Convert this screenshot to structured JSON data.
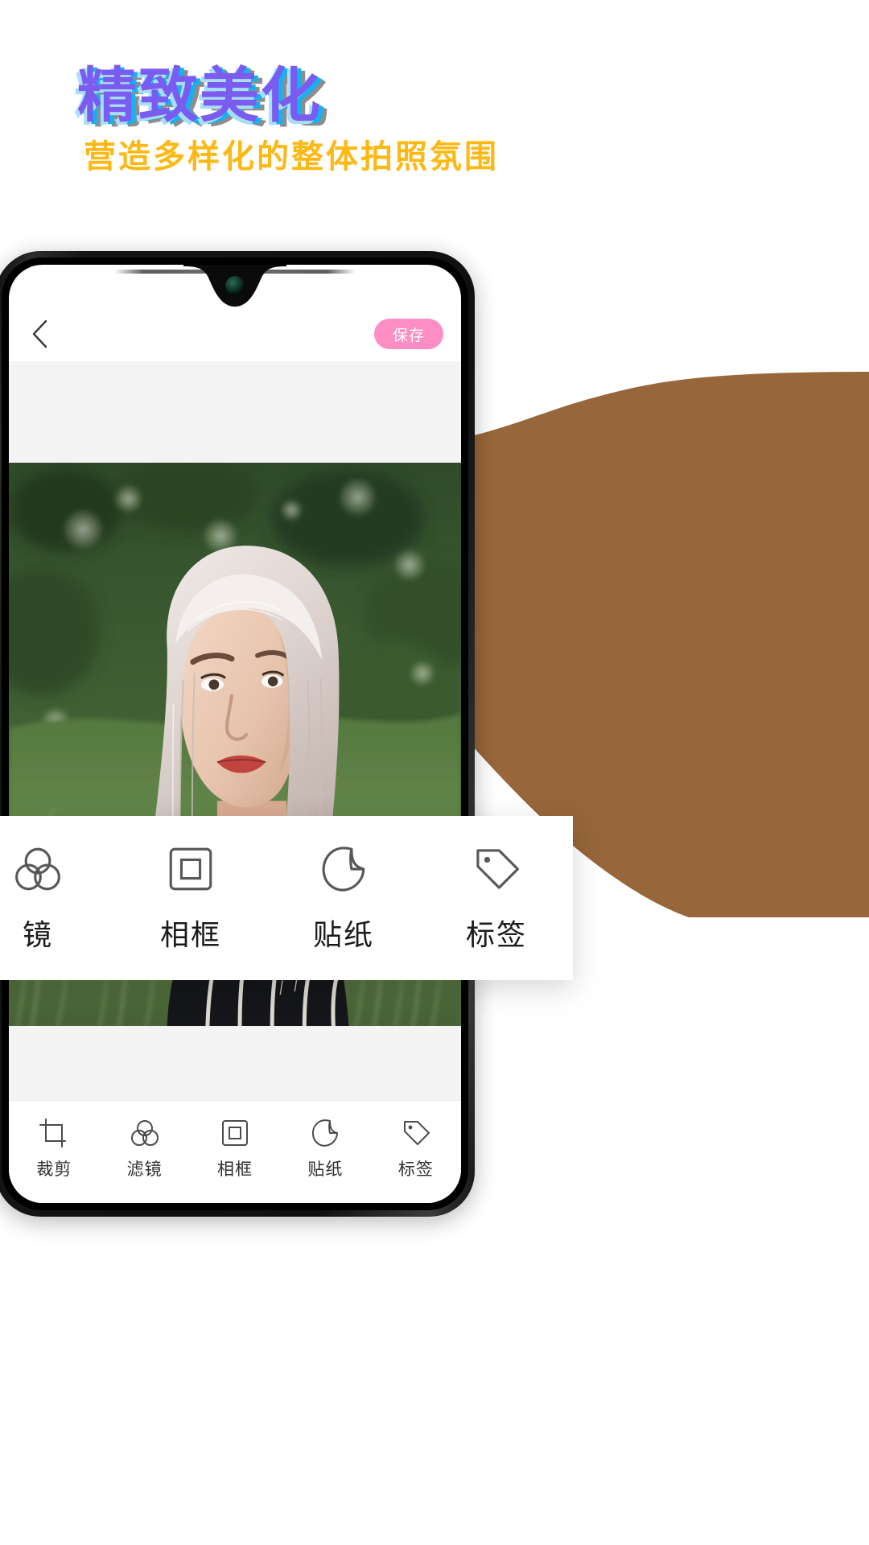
{
  "headings": {
    "title": "精致美化",
    "subtitle": "营造多样化的整体拍照氛围",
    "title_colors": {
      "main": "#7a5cf0",
      "cyan": "#10b4f5",
      "sky": "#a8def8",
      "gray": "#8d8d8d"
    },
    "subtitle_color": "#fdb813"
  },
  "decor": {
    "blob_color": "#97663a",
    "blob_name": "brown-wave-shape"
  },
  "phone": {
    "app_header": {
      "back_icon": "chevron-left-icon",
      "save_label": "保存",
      "save_color": "#fd8ec3"
    },
    "canvas": {
      "background": "#f4f4f4",
      "photo_alt": "portrait-photo"
    },
    "toolbar": {
      "items": [
        {
          "label": "裁剪",
          "icon": "crop-icon"
        },
        {
          "label": "滤镜",
          "icon": "filter-circles-icon"
        },
        {
          "label": "相框",
          "icon": "frame-icon"
        },
        {
          "label": "贴纸",
          "icon": "sticker-icon"
        },
        {
          "label": "标签",
          "icon": "tag-icon"
        }
      ]
    }
  },
  "float_panel": {
    "items": [
      {
        "label": "镜",
        "icon": "filter-circles-icon"
      },
      {
        "label": "相框",
        "icon": "frame-icon"
      },
      {
        "label": "贴纸",
        "icon": "sticker-icon"
      },
      {
        "label": "标签",
        "icon": "tag-icon"
      }
    ]
  }
}
